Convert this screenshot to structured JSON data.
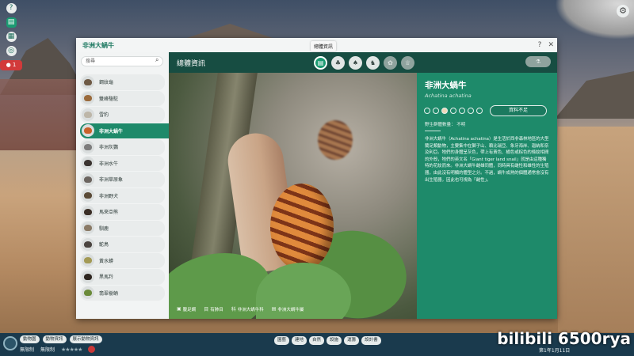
{
  "window": {
    "title": "非洲大蝸牛",
    "help": "?",
    "close": "✕"
  },
  "tooltip": "總體資訊",
  "search": {
    "placeholder": "搜尋"
  },
  "sidebar": {
    "items": [
      {
        "label": "鋼紋龜"
      },
      {
        "label": "雙峰駱駝"
      },
      {
        "label": "雪豹"
      },
      {
        "label": "非洲大蝸牛"
      },
      {
        "label": "非洲灰鸚"
      },
      {
        "label": "非洲水牛"
      },
      {
        "label": "非洲草原象"
      },
      {
        "label": "非洲野犬"
      },
      {
        "label": "馬來亞熊"
      },
      {
        "label": "馴鹿"
      },
      {
        "label": "鴕鳥"
      },
      {
        "label": "黃水蟒"
      },
      {
        "label": "黑馬羚"
      },
      {
        "label": "翡翠樹蚺"
      }
    ]
  },
  "header": {
    "section_title": "總體資訊"
  },
  "taxonomy": [
    {
      "label": "腹足綱"
    },
    {
      "label": "有肺目"
    },
    {
      "label": "非洲大蝸牛科"
    },
    {
      "label": "非洲大蝸牛屬"
    }
  ],
  "info": {
    "name": "非洲大蝸牛",
    "latin": "Achatina achatina",
    "status_button": "資料不足",
    "wild": "野生群體數量： 不明",
    "description": "非洲大蝸牛（Achatina achatina）是生活於西非森林地區的大型蘭足類動物，主要集中在獅子山、賴比瑞亞、象牙海岸、迦納和奈及利亞。牠們的身體呈灰色，帶上有黃色、橘色或棕色的條紋相間的外殼，牠們的英文名「Giant tiger land snail」就是由這種獨特的花紋而來。非洲大蝸牛雌雄同體，同時具有雌性和雄性的生殖器，由此沒有明顯的體型之分。不過，蝸牛成熟的個體通常會沒有出生殖器，因此也可視為「雌性」。"
  },
  "bottombar": {
    "animals": "動物園",
    "zoo_info": "動物資訊",
    "exhibit": "展示動物資訊",
    "budget1": "無限制",
    "budget2": "無限制",
    "tools": [
      "園藝",
      "建地",
      "自然",
      "設施",
      "運籌",
      "設計書"
    ],
    "date": "第1年1月11日"
  },
  "watermark": "bilibili 6500rya",
  "colors": {
    "accent": "#1e8a6a",
    "dark": "#174d42"
  }
}
